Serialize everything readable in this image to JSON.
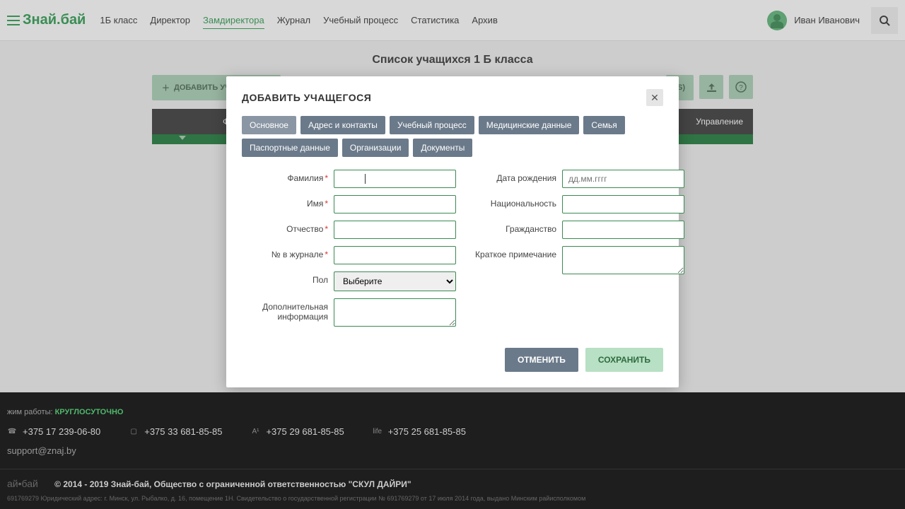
{
  "brand": "Знай.бай",
  "nav": [
    "1Б класс",
    "Директор",
    "Замдиректора",
    "Журнал",
    "Учебный процесс",
    "Статистика",
    "Архив"
  ],
  "nav_active": 2,
  "user_name": "Иван Иванович",
  "page_title": "Список учащихся 1 Б класса",
  "toolbar": {
    "add_label": "ДОБАВИТЬ УЧАЩЕГОСЯ",
    "s_btn": "(S)"
  },
  "table": {
    "col_left": "Ф",
    "col_right": "Управление"
  },
  "modal": {
    "title": "ДОБАВИТЬ УЧАЩЕГОСЯ",
    "tabs": [
      "Основное",
      "Адрес и контакты",
      "Учебный процесс",
      "Медицинские данные",
      "Семья",
      "Паспортные данные",
      "Организации",
      "Документы"
    ],
    "tab_active": 0,
    "labels": {
      "surname": "Фамилия",
      "name": "Имя",
      "patronymic": "Отчество",
      "journal_no": "№ в журнале",
      "gender": "Пол",
      "extra": "Дополнительная информация",
      "dob": "Дата рождения",
      "nationality": "Национальность",
      "citizenship": "Гражданство",
      "note": "Краткое примечание"
    },
    "gender_placeholder": "Выберите",
    "dob_placeholder": "дд.мм.гггг",
    "cancel": "ОТМЕНИТЬ",
    "save": "СОХРАНИТЬ"
  },
  "footer": {
    "hours_prefix": "жим работы: ",
    "hours_value": "КРУГЛОСУТОЧНО",
    "phones": [
      "+375 17 239-06-80",
      "+375 33 681-85-85",
      "+375 29 681-85-85",
      "+375 25 681-85-85"
    ],
    "email": "support@znaj.by",
    "logo": "ай•бай",
    "copyright": "© 2014 - 2019 Знай-бай, Общество с ограниченной ответственностью \"СКУЛ ДАЙРИ\"",
    "legal": "691769279 Юридический адрес: г. Минск, ул. Рыбалко, д. 16, помещение 1Н. Свидетельство о государственной регистрации № 691769279 от 17 июля 2014 года, выдано Минским райисполкомом"
  }
}
